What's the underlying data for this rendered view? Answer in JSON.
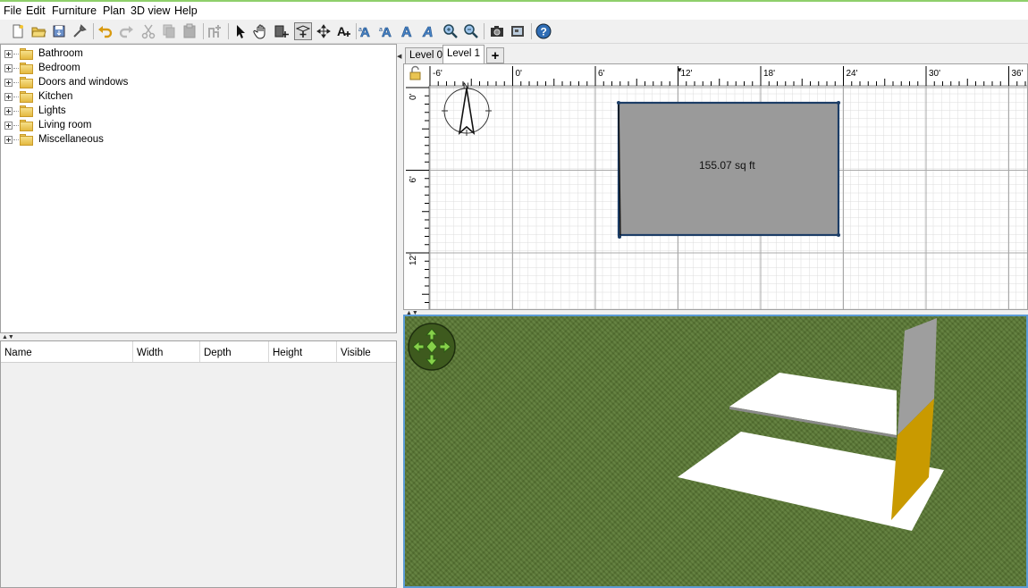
{
  "menu": [
    "File",
    "Edit",
    "Furniture",
    "Plan",
    "3D view",
    "Help"
  ],
  "toolbar": {
    "icons": [
      "new-home-icon",
      "open-icon",
      "save-icon",
      "preferences-icon",
      "undo-icon",
      "redo-icon",
      "cut-icon",
      "copy-icon",
      "paste-icon",
      "add-furniture-icon",
      "select-icon",
      "pan-icon",
      "create-walls-icon",
      "create-rooms-icon",
      "create-dimensions-icon",
      "add-text-icon",
      "text-style-icon",
      "zoom-in-icon",
      "zoom-out-icon",
      "create-photo-icon",
      "create-video-icon",
      "help-icon"
    ]
  },
  "catalog": {
    "categories": [
      "Bathroom",
      "Bedroom",
      "Doors and windows",
      "Kitchen",
      "Lights",
      "Living room",
      "Miscellaneous"
    ]
  },
  "furniture_table": {
    "columns": [
      "Name",
      "Width",
      "Depth",
      "Height",
      "Visible"
    ]
  },
  "levels": {
    "tabs": [
      "Level 0",
      "Level 1"
    ],
    "active": "Level 1",
    "add_label": "+"
  },
  "plan": {
    "ruler_x": [
      "-6'",
      "0'",
      "6'",
      "12'",
      "18'",
      "24'",
      "30'",
      "36'"
    ],
    "ruler_y": [
      "0'",
      "6'",
      "12'"
    ],
    "room_area": "155.07 sq ft",
    "compass_letter": "N",
    "colors": {
      "room_fill": "#9a9a9a",
      "wall": "#1c3d66",
      "grid": "#d6d6d6"
    }
  },
  "view3d": {
    "colors": {
      "ground": "#5b7a35",
      "floor": "#ffffff",
      "wall_upper": "#9e9e9e",
      "wall_lower": "#c99a00",
      "nav": "#5aa82a"
    }
  }
}
